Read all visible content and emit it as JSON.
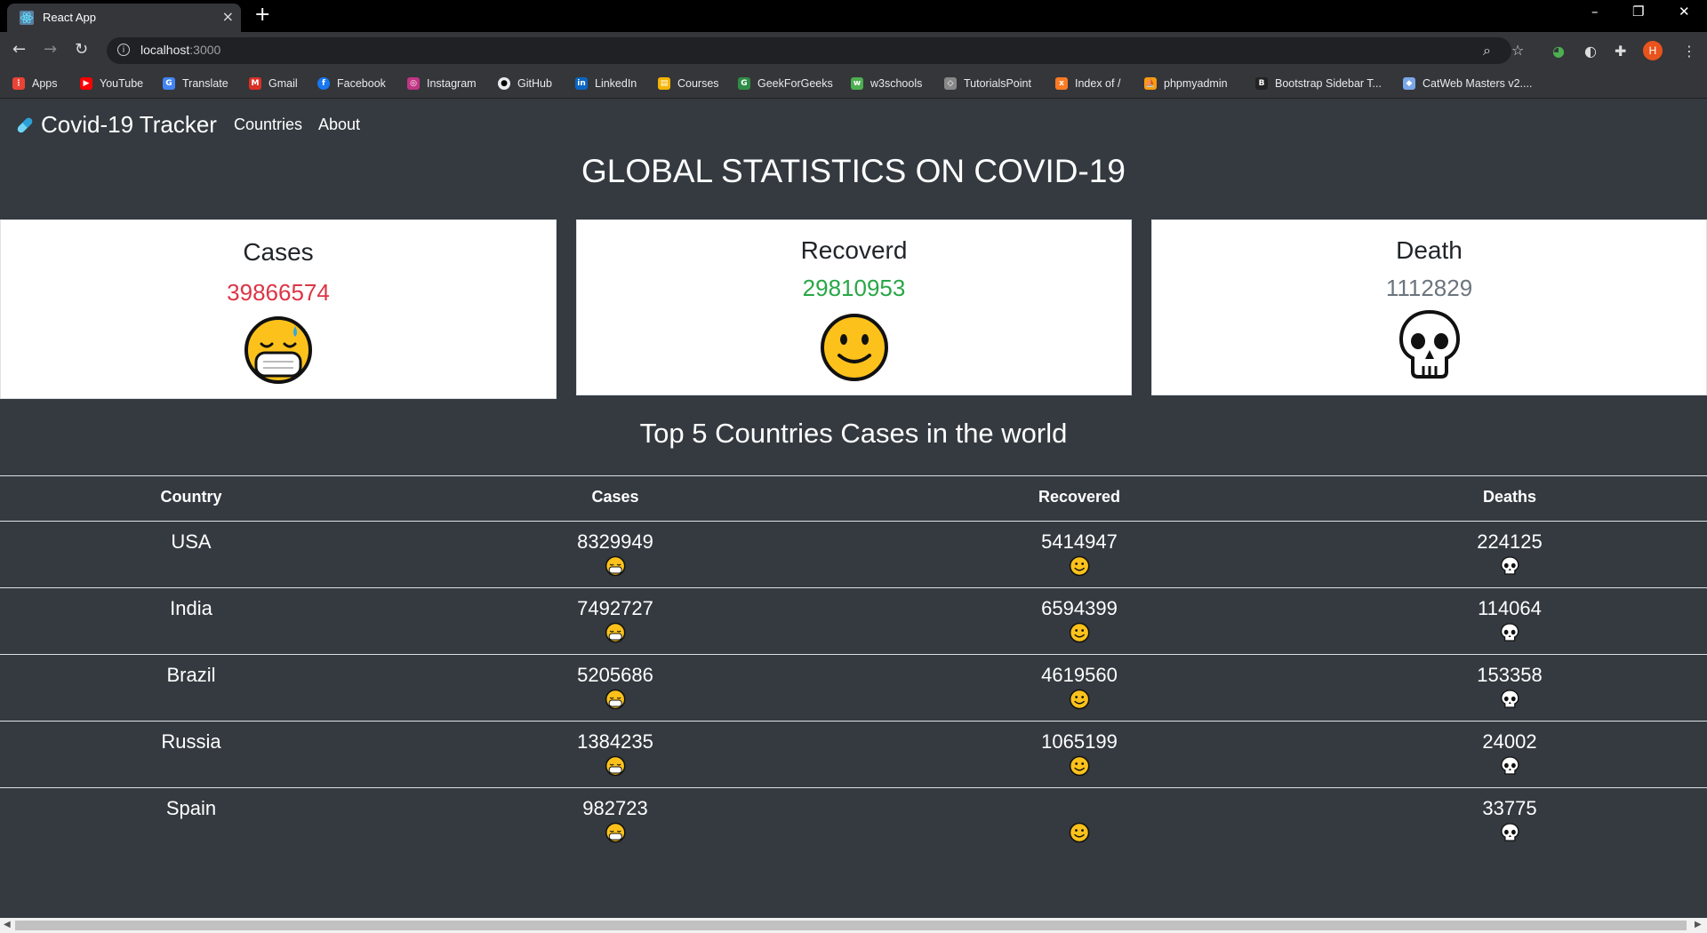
{
  "browser": {
    "tab_title": "React App",
    "tab_close": "×",
    "new_tab": "+",
    "url_host": "localhost",
    "url_port": ":3000",
    "window_controls": [
      "–",
      "❐",
      "✕"
    ],
    "profile_initial": "H",
    "bookmarks": [
      {
        "label": "Apps",
        "icon": "apps-grid-icon",
        "color": "#ea4335"
      },
      {
        "label": "YouTube",
        "icon": "youtube-icon",
        "color": "#ff0000"
      },
      {
        "label": "Translate",
        "icon": "translate-icon",
        "color": "#4285f4"
      },
      {
        "label": "Gmail",
        "icon": "gmail-icon",
        "color": "#d93025"
      },
      {
        "label": "Facebook",
        "icon": "facebook-icon",
        "color": "#1877f2"
      },
      {
        "label": "Instagram",
        "icon": "instagram-icon",
        "color": "#c13584"
      },
      {
        "label": "GitHub",
        "icon": "github-icon",
        "color": "#e8eaed"
      },
      {
        "label": "LinkedIn",
        "icon": "linkedin-icon",
        "color": "#0a66c2"
      },
      {
        "label": "Courses",
        "icon": "google-classroom-icon",
        "color": "#f4b400"
      },
      {
        "label": "GeekForGeeks",
        "icon": "geeksforgeeks-icon",
        "color": "#2f8d46"
      },
      {
        "label": "w3schools",
        "icon": "w3schools-icon",
        "color": "#4caf50"
      },
      {
        "label": "TutorialsPoint",
        "icon": "tutorialspoint-icon",
        "color": "#888888"
      },
      {
        "label": "Index of /",
        "icon": "xampp-icon",
        "color": "#fb7a24"
      },
      {
        "label": "phpmyadmin",
        "icon": "phpmyadmin-icon",
        "color": "#f89c0e"
      },
      {
        "label": "Bootstrap Sidebar T...",
        "icon": "bootstrap-icon",
        "color": "#222222"
      },
      {
        "label": "CatWeb Masters v2....",
        "icon": "catweb-icon",
        "color": "#7aa7e8"
      }
    ]
  },
  "app": {
    "brand": "Covid-19 Tracker",
    "nav": [
      "Countries",
      "About"
    ],
    "page_title": "GLOBAL STATISTICS ON COVID-19",
    "cards": [
      {
        "title": "Cases",
        "value": "39866574",
        "color": "#dc3545",
        "emoji": "mask-face-emoji"
      },
      {
        "title": "Recoverd",
        "value": "29810953",
        "color": "#28a745",
        "emoji": "smile-face-emoji"
      },
      {
        "title": "Death",
        "value": "1112829",
        "color": "#6c757d",
        "emoji": "skull-emoji"
      }
    ],
    "section_title": "Top 5 Countries Cases in the world",
    "table": {
      "headers": [
        "Country",
        "Cases",
        "Recovered",
        "Deaths"
      ],
      "rows": [
        {
          "country": "USA",
          "cases": "8329949",
          "recovered": "5414947",
          "deaths": "224125"
        },
        {
          "country": "India",
          "cases": "7492727",
          "recovered": "6594399",
          "deaths": "114064"
        },
        {
          "country": "Brazil",
          "cases": "5205686",
          "recovered": "4619560",
          "deaths": "153358"
        },
        {
          "country": "Russia",
          "cases": "1384235",
          "recovered": "1065199",
          "deaths": "24002"
        },
        {
          "country": "Spain",
          "cases": "982723",
          "recovered": "",
          "deaths": "33775"
        }
      ]
    }
  }
}
